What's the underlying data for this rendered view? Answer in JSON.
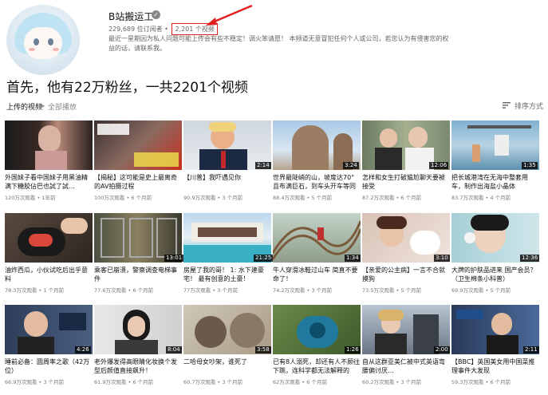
{
  "channel": {
    "name": "B站搬运工",
    "subscribers": "229,689 位订阅者",
    "video_count": "2,201 个视频",
    "description": "最近一星期因为私人问题可能上传会有些不稳定！调火笨请愿！ 本频道无意冒犯任何个人或公司，若您认为有侵害您的权益的话，请联系我。"
  },
  "caption": "首先，他有22万粉丝，一共2201个视频",
  "section": {
    "title": "上传的视频",
    "play_all": "全部播放",
    "sort": "排序方式"
  },
  "colors": {
    "highlight": "#e02020"
  },
  "videos": [
    {
      "title": "外国妹子看中国妹子用黑油精满下糖胶佔巴也試了試…",
      "meta": "120万次观看 • 1年前",
      "duration": ""
    },
    {
      "title": "【揭秘】这可能是史上最离奇的AV拍摄过程",
      "meta": "100万次观看 • 6 个月前",
      "duration": ""
    },
    {
      "title": "【川普】我吓遇见你",
      "meta": "90.9万次观看 • 3 个月前",
      "duration": "2:14"
    },
    {
      "title": "世界最陡峭的山，坡度达70°且布满巨石，到车头开车等同死",
      "meta": "88.4万次观看 • 5 个月前",
      "duration": "3:24"
    },
    {
      "title": "怎样和女生打破尴尬聊天要被接受",
      "meta": "87.2万次观看 • 6 个月前",
      "duration": "12:06"
    },
    {
      "title": "把长城港湾在无海中整套用车，制作出海盐小晶体",
      "meta": "83.7万次观看 • 4 个月前",
      "duration": "1:35"
    },
    {
      "title": "油炸西瓜，小伙试吃后出乎意料",
      "meta": "78.3万次观看 • 1 个月前",
      "duration": ""
    },
    {
      "title": "乘客已崩溃，警察调查电梯事件",
      "meta": "77.6万次观看 • 6 个月前",
      "duration": "13:01"
    },
    {
      "title": "房屋了我的哥！ 1: 水下建豪宅！ 最有创意的土豪！",
      "meta": "77万次观看 • 3 个月前",
      "duration": "21:25"
    },
    {
      "title": "牛人穿滑冰鞋过山车 简直不要命了！",
      "meta": "74.2万次观看 • 3 个月前",
      "duration": "1:34"
    },
    {
      "title": "【亲爱的公主病】一言不合就摸狗",
      "meta": "73.5万次观看 • 5 个月前",
      "duration": "3:10"
    },
    {
      "title": "大牌的护肤品进来 国产会员？（卫生棉条小科普）",
      "meta": "69.9万次观看 • 5 个月前",
      "duration": "12:36"
    },
    {
      "title": "睡前必备：圆周率之歌（42万位）",
      "meta": "66.9万次观看 • 3 个月前",
      "duration": "4:26"
    },
    {
      "title": "老外爆发得高眼睛化妆换个发型后颜值直接飙升！",
      "meta": "61.9万次观看 • 6 个月前",
      "duration": "8:04"
    },
    {
      "title": "二哈母女吵架，谁死了",
      "meta": "60.7万次观看 • 3 个月前",
      "duration": "3:58"
    },
    {
      "title": "已有8人溺死，却还有人不顾往下跳，连科学都无法解释的",
      "meta": "62万次观看 • 6 个月前",
      "duration": "1:26"
    },
    {
      "title": "自从这群亚美仁被中式英语弯腰偏讨厌…",
      "meta": "60.2万次观看 • 3 个月前",
      "duration": "2:00"
    },
    {
      "title": "【BBC】英国美女用中国菜推理事件大发现",
      "meta": "59.3万次观看 • 6 个月前",
      "duration": "2:11"
    }
  ]
}
